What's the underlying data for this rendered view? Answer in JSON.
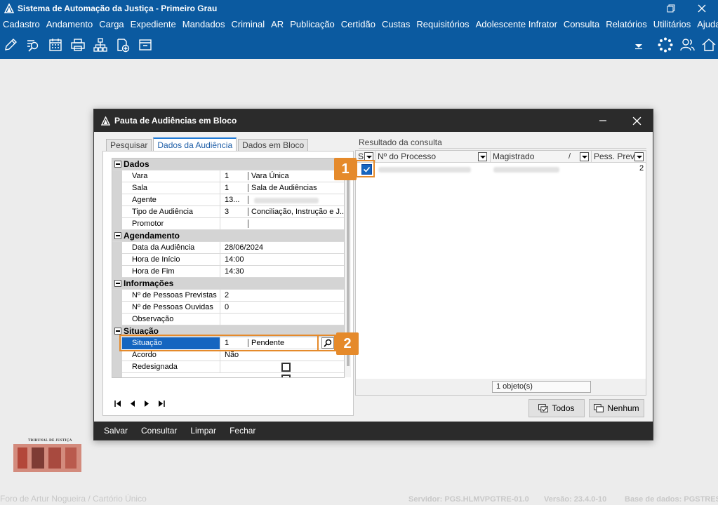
{
  "app": {
    "title": "Sistema de Automação da Justiça - Primeiro Grau"
  },
  "menu": [
    "Cadastro",
    "Andamento",
    "Carga",
    "Expediente",
    "Mandados",
    "Criminal",
    "AR",
    "Publicação",
    "Certidão",
    "Custas",
    "Requisitórios",
    "Adolescente Infrator",
    "Consulta",
    "Relatórios",
    "Utilitários",
    "Ajuda"
  ],
  "toolbar_icons": [
    "edit-icon",
    "search-process-icon",
    "calendar-icon",
    "printer-icon",
    "hierarchy-icon",
    "new-item-icon",
    "archive-icon"
  ],
  "dialog": {
    "title": "Pauta de Audiências em Bloco",
    "tabs": [
      "Pesquisar",
      "Dados da Audiência",
      "Dados em Bloco"
    ],
    "active_tab": "Dados da Audiência",
    "categories": {
      "dados": "Dados",
      "agendamento": "Agendamento",
      "informacoes": "Informações",
      "situacao": "Situação"
    },
    "rows": {
      "vara": {
        "label": "Vara",
        "code": "1",
        "value": "Vara Única"
      },
      "sala": {
        "label": "Sala",
        "code": "1",
        "value": "Sala de Audiências"
      },
      "agente": {
        "label": "Agente",
        "code": "13..."
      },
      "tipo": {
        "label": "Tipo de Audiência",
        "code": "3",
        "value": "Conciliação, Instrução e J..."
      },
      "promotor": {
        "label": "Promotor"
      },
      "data": {
        "label": "Data da Audiência",
        "value": "28/06/2024"
      },
      "hora_inicio": {
        "label": "Hora de Início",
        "value": "14:00"
      },
      "hora_fim": {
        "label": "Hora de Fim",
        "value": "14:30"
      },
      "previstas": {
        "label": "Nº de Pessoas Previstas",
        "value": "2"
      },
      "ouvidas": {
        "label": "Nº de Pessoas Ouvidas",
        "value": "0"
      },
      "observacao": {
        "label": "Observação"
      },
      "situacao": {
        "label": "Situação",
        "code": "1",
        "value": "Pendente"
      },
      "acordo": {
        "label": "Acordo",
        "value": "Não"
      },
      "redesignada": {
        "label": "Redesignada"
      }
    },
    "results": {
      "label": "Resultado da consulta",
      "columns": [
        "S",
        "Nº do Processo",
        "Magistrado",
        "Pess. Prev."
      ],
      "row_pess_prev": "2",
      "count": "1 objeto(s)"
    },
    "buttons": {
      "todos": "Todos",
      "nenhum": "Nenhum"
    },
    "bottom": [
      "Salvar",
      "Consultar",
      "Limpar",
      "Fechar"
    ]
  },
  "callouts": [
    "1",
    "2"
  ],
  "crest_text": "TRIBUNAL DE JUSTIÇA",
  "footer": {
    "left": "Foro de Artur Nogueira / Cartório Único",
    "server": "Servidor: PGS.HLMVPGTRE-01.0",
    "version": "Versão: 23.4.0-10",
    "db": "Base de dados: PGSTRES"
  },
  "colors": {
    "header_blue": "#0b5aa0",
    "dialog_dark": "#2b2b2b",
    "callout_orange": "#e58a2b",
    "selection_blue": "#1565c0"
  }
}
